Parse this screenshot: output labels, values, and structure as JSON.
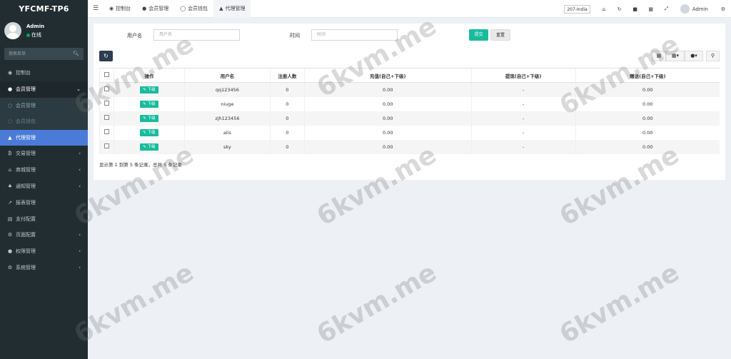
{
  "brand": "YFCMF-TP6",
  "user": {
    "name": "Admin",
    "status": "在线"
  },
  "sidebar_search": {
    "placeholder": "搜索菜单"
  },
  "menu": [
    {
      "label": "控制台",
      "icon": "dashboard-icon"
    },
    {
      "label": "会员管理",
      "icon": "user-icon",
      "open": true
    },
    {
      "label": "会员管理",
      "sub": true
    },
    {
      "label": "会员钱包",
      "sub": true
    },
    {
      "label": "代理管理",
      "icon": "sitemap-icon",
      "active": true
    },
    {
      "label": "交易管理",
      "icon": "bitcoin-icon"
    },
    {
      "label": "商城管理",
      "icon": "home-icon"
    },
    {
      "label": "通知管理",
      "icon": "bell-icon"
    },
    {
      "label": "报表管理",
      "icon": "chart-icon"
    },
    {
      "label": "支付配置",
      "icon": "card-icon"
    },
    {
      "label": "页面配置",
      "icon": "cog-icon"
    },
    {
      "label": "权限管理",
      "icon": "users-icon"
    },
    {
      "label": "系统管理",
      "icon": "cogs-icon"
    }
  ],
  "tabs": [
    {
      "label": "控制台"
    },
    {
      "label": "会员管理"
    },
    {
      "label": "会员钱包"
    },
    {
      "label": "代理管理"
    }
  ],
  "topbar": {
    "region": "207-India",
    "user": "Admin"
  },
  "filters": {
    "username_label": "用户名",
    "username_placeholder": "用户名",
    "time_label": "时间",
    "time_placeholder": "时间",
    "submit": "提交",
    "reset": "重置"
  },
  "table": {
    "headers": [
      "操作",
      "用户名",
      "注册人数",
      "充值(自己+下级)",
      "提现(自己+下级)",
      "赠送(自己+下级)"
    ],
    "action_label": "下级",
    "rows": [
      [
        "qq123456",
        "0",
        "0.00",
        "-",
        "0.00"
      ],
      [
        "niuge",
        "0",
        "0.00",
        "-",
        "0.00"
      ],
      [
        "zjh123456",
        "0",
        "0.00",
        "-",
        "0.00"
      ],
      [
        "alis",
        "0",
        "0.00",
        "-",
        "0.00"
      ],
      [
        "sky",
        "0",
        "0.00",
        "-",
        "0.00"
      ]
    ]
  },
  "pager_text": "显示第 1 到第 5 条记录，总共 5 条记录",
  "watermark": "6kvm.me"
}
